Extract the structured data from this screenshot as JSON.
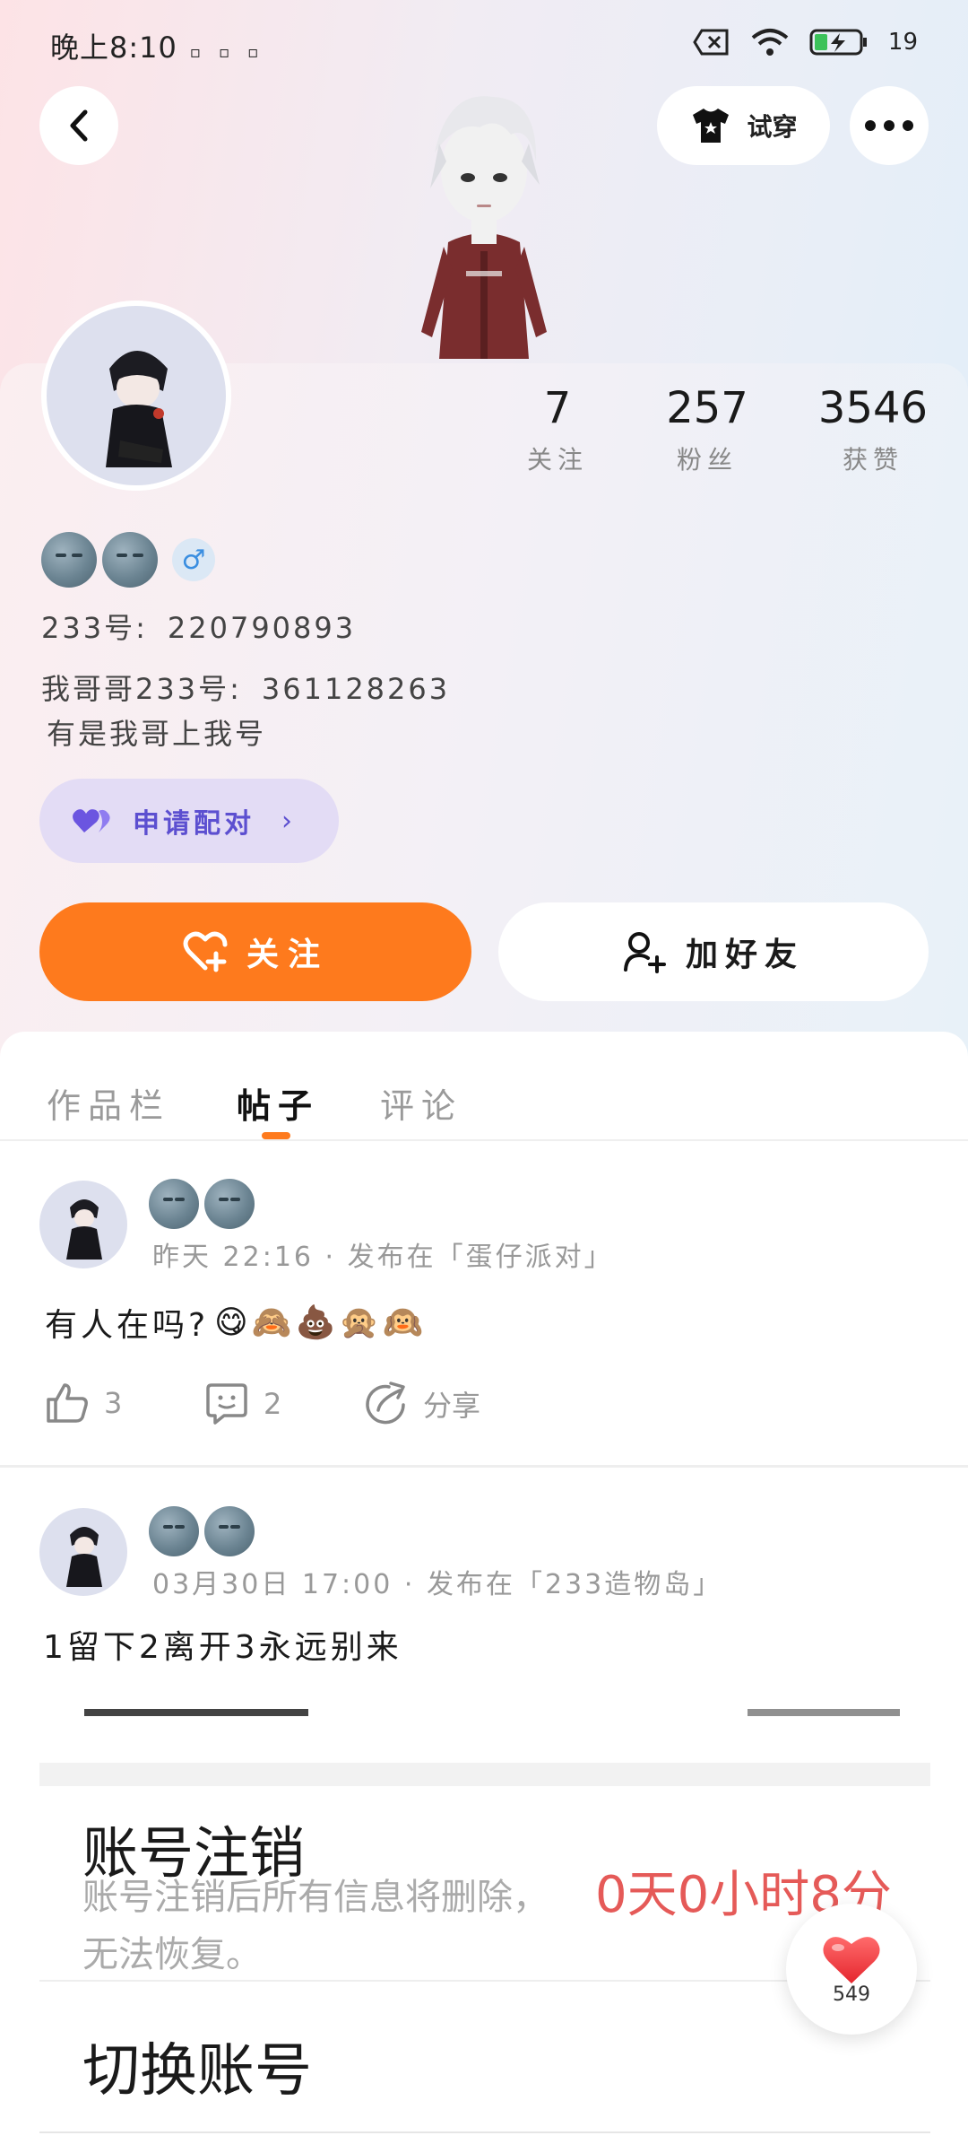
{
  "status_bar": {
    "time": "晚上8:10",
    "battery_percent": "19"
  },
  "header": {
    "tryon_label": "试穿"
  },
  "profile": {
    "stats": [
      {
        "value": "7",
        "label": "关注"
      },
      {
        "value": "257",
        "label": "粉丝"
      },
      {
        "value": "3546",
        "label": "获赞"
      }
    ],
    "id_label": "233号:",
    "id_value": "220790893",
    "brother_label": "我哥哥233号:",
    "brother_value": "361128263",
    "bio": "有是我哥上我号",
    "match_label": "申请配对",
    "follow_label": "关注",
    "add_friend_label": "加好友"
  },
  "tabs": [
    {
      "label": "作品栏"
    },
    {
      "label": "帖子"
    },
    {
      "label": "评论"
    }
  ],
  "posts": [
    {
      "meta": "昨天 22:16 · 发布在「蛋仔派对」",
      "text": "有人在吗?",
      "emojis": "😋🙈💩🙊🙉",
      "likes": "3",
      "comments": "2",
      "share_label": "分享"
    },
    {
      "meta": "03月30日 17:00 · 发布在「233造物岛」",
      "text": "1留下2离开3永远别来"
    }
  ],
  "overlay": {
    "title": "账号注销",
    "description": "账号注销后所有信息将删除，无法恢复。",
    "countdown": "0天0小时8分",
    "switch_account": "切换账号"
  },
  "like_fab": {
    "count": "549"
  },
  "colors": {
    "accent_orange": "#fe7a1d",
    "match_purple": "#5c4fd0",
    "countdown_red": "#e55a58"
  }
}
